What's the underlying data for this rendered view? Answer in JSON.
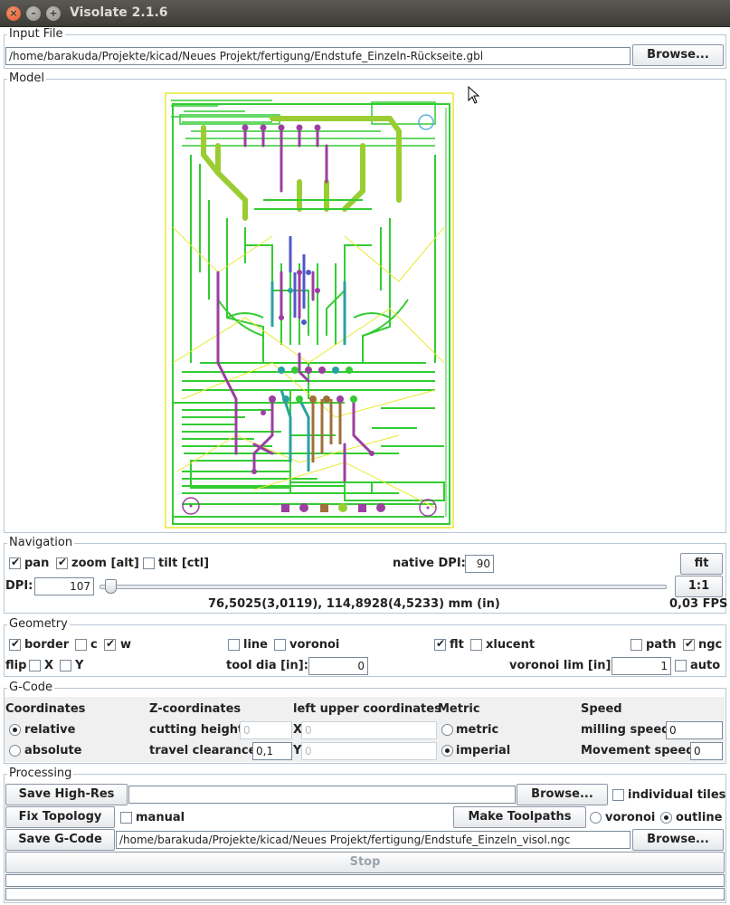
{
  "window": {
    "title": "Visolate 2.1.6"
  },
  "input_file": {
    "section": "Input File",
    "path": "/home/barakuda/Projekte/kicad/Neues Projekt/fertigung/Endstufe_Einzeln-Rückseite.gbl",
    "browse": "Browse..."
  },
  "model": {
    "section": "Model"
  },
  "navigation": {
    "section": "Navigation",
    "pan": {
      "label": "pan",
      "checked": true
    },
    "zoom": {
      "label": "zoom [alt]",
      "checked": true
    },
    "tilt": {
      "label": "tilt [ctl]",
      "checked": false
    },
    "native_dpi_label": "native DPI:",
    "native_dpi_value": "90",
    "fit": "fit",
    "dpi_label": "DPI:",
    "dpi_value": "107",
    "one_to_one": "1:1",
    "coords": "76,5025(3,0119), 114,8928(4,5233) mm (in)",
    "fps": "0,03 FPS",
    "slider_fraction": 0.01
  },
  "geometry": {
    "section": "Geometry",
    "border": "border",
    "c": "c",
    "w": "w",
    "line": "line",
    "voronoi": "voronoi",
    "flt": "flt",
    "xlucent": "xlucent",
    "path": "path",
    "ngc": "ngc",
    "flip": "flip",
    "x": "X",
    "y": "Y",
    "tool_dia_label": "tool dia [in]:",
    "tool_dia_value": "0",
    "voronoi_lim_label": "voronoi lim [in]:",
    "voronoi_lim_value": "1",
    "auto": "auto"
  },
  "gcode": {
    "section": "G-Code",
    "coordinates": "Coordinates",
    "relative": "relative",
    "absolute": "absolute",
    "z_coordinates": "Z-coordinates",
    "cutting_height": "cutting height",
    "cutting_height_value": "0",
    "travel_clearance": "travel clearance",
    "travel_clearance_value": "0,1",
    "left_upper": "left upper coordinates",
    "x": "X",
    "x_value": "0",
    "y": "Y",
    "y_value": "0",
    "metric_header": "Metric",
    "metric": "metric",
    "imperial": "imperial",
    "speed": "Speed",
    "milling_speed": "milling speed",
    "milling_speed_value": "0",
    "movement_speed": "Movement speed",
    "movement_speed_value": "0"
  },
  "processing": {
    "section": "Processing",
    "save_high_res": "Save High-Res",
    "browse1": "Browse...",
    "individual_tiles": "individual tiles",
    "fix_topology": "Fix Topology",
    "manual": "manual",
    "make_toolpaths": "Make Toolpaths",
    "voronoi": "voronoi",
    "outline": "outline",
    "save_gcode": "Save G-Code",
    "gcode_path": "/home/barakuda/Projekte/kicad/Neues Projekt/fertigung/Endstufe_Einzeln_visol.ngc",
    "browse2": "Browse...",
    "stop": "Stop"
  },
  "colors": {
    "trace_green": "#33cc33",
    "trace_yellow": "#e8e830",
    "trace_lime": "#9acd32",
    "trace_purple": "#9b3fa0",
    "trace_teal": "#2aa1a1",
    "trace_brown": "#a0703a",
    "trace_blue": "#5058c8"
  }
}
